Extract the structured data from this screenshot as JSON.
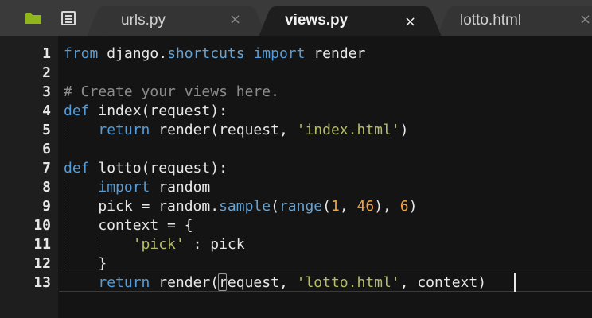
{
  "tabs": [
    {
      "label": "urls.py",
      "close": "×",
      "active": false
    },
    {
      "label": "views.py",
      "close": "×",
      "active": true
    },
    {
      "label": "lotto.html",
      "close": "×",
      "active": false
    }
  ],
  "toolbar": {
    "folder_icon": "folder-icon",
    "files_icon": "file-list-icon",
    "folder_color": "#8fb61a"
  },
  "editor": {
    "line_numbers": [
      "1",
      "2",
      "3",
      "4",
      "5",
      "6",
      "7",
      "8",
      "9",
      "10",
      "11",
      "12",
      "13"
    ],
    "current_line": 13,
    "lines": [
      [
        {
          "t": "kw",
          "v": "from"
        },
        {
          "t": "txt",
          "v": " django."
        },
        {
          "t": "fn",
          "v": "shortcuts"
        },
        {
          "t": "txt",
          "v": " "
        },
        {
          "t": "kw",
          "v": "import"
        },
        {
          "t": "txt",
          "v": " render"
        }
      ],
      [],
      [
        {
          "t": "cmt",
          "v": "# Create your views here."
        }
      ],
      [
        {
          "t": "kw",
          "v": "def"
        },
        {
          "t": "txt",
          "v": " index(request):"
        }
      ],
      [
        {
          "t": "txt",
          "v": "    "
        },
        {
          "t": "kw",
          "v": "return"
        },
        {
          "t": "txt",
          "v": " render(request, "
        },
        {
          "t": "str",
          "v": "'index.html'"
        },
        {
          "t": "txt",
          "v": ")"
        }
      ],
      [],
      [
        {
          "t": "kw",
          "v": "def"
        },
        {
          "t": "txt",
          "v": " lotto(request):"
        }
      ],
      [
        {
          "t": "txt",
          "v": "    "
        },
        {
          "t": "kw",
          "v": "import"
        },
        {
          "t": "txt",
          "v": " random"
        }
      ],
      [
        {
          "t": "txt",
          "v": "    pick = random."
        },
        {
          "t": "fn",
          "v": "sample"
        },
        {
          "t": "txt",
          "v": "("
        },
        {
          "t": "fn",
          "v": "range"
        },
        {
          "t": "txt",
          "v": "("
        },
        {
          "t": "num",
          "v": "1"
        },
        {
          "t": "txt",
          "v": ", "
        },
        {
          "t": "num",
          "v": "46"
        },
        {
          "t": "txt",
          "v": "), "
        },
        {
          "t": "num",
          "v": "6"
        },
        {
          "t": "txt",
          "v": ")"
        }
      ],
      [
        {
          "t": "txt",
          "v": "    context = {"
        }
      ],
      [
        {
          "t": "txt",
          "v": "        "
        },
        {
          "t": "str",
          "v": "'pick'"
        },
        {
          "t": "txt",
          "v": " : pick"
        }
      ],
      [
        {
          "t": "txt",
          "v": "    }"
        }
      ],
      [
        {
          "t": "txt",
          "v": "    "
        },
        {
          "t": "kw",
          "v": "return"
        },
        {
          "t": "txt",
          "v": " render(request, "
        },
        {
          "t": "str",
          "v": "'lotto.html'"
        },
        {
          "t": "txt",
          "v": ", context)"
        }
      ]
    ]
  },
  "colors": {
    "tabbar": "#3a3a3a",
    "editor_bg": "#141414",
    "keyword": "#569cd6",
    "string": "#b5bd68",
    "number": "#f0a045",
    "comment": "#8c8c8c"
  }
}
